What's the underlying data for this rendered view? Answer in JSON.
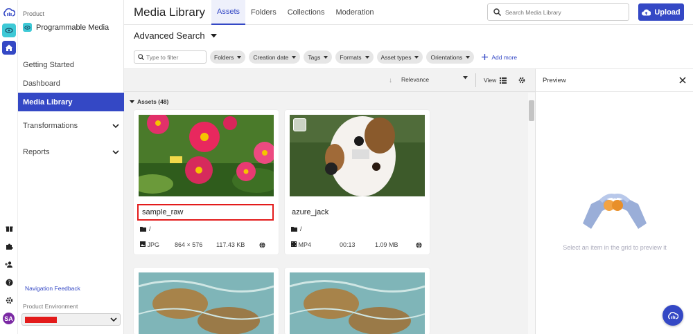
{
  "sidebar": {
    "product_label": "Product",
    "product_name": "Programmable Media",
    "items": [
      {
        "label": "Getting Started"
      },
      {
        "label": "Dashboard"
      },
      {
        "label": "Media Library"
      },
      {
        "label": "Transformations"
      },
      {
        "label": "Reports"
      }
    ],
    "feedback_link": "Navigation Feedback",
    "env_label": "Product Environment",
    "avatar_initials": "SA"
  },
  "header": {
    "title": "Media Library",
    "tabs": [
      {
        "label": "Assets"
      },
      {
        "label": "Folders"
      },
      {
        "label": "Collections"
      },
      {
        "label": "Moderation"
      }
    ],
    "search_placeholder": "Search Media Library",
    "upload_label": "Upload"
  },
  "search": {
    "advanced_label": "Advanced Search",
    "filter_placeholder": "Type to filter",
    "chips": [
      "Folders",
      "Creation date",
      "Tags",
      "Formats",
      "Asset types",
      "Orientations"
    ],
    "add_more": "Add more"
  },
  "grid": {
    "sort_label": "Relevance",
    "view_label": "View",
    "assets_count": "Assets (48)",
    "cards": [
      {
        "name": "sample_raw",
        "folder": "/",
        "type": "JPG",
        "info": "864 × 576",
        "size": "117.43 KB"
      },
      {
        "name": "azure_jack",
        "folder": "/",
        "type": "MP4",
        "info": "00:13",
        "size": "1.09 MB"
      }
    ]
  },
  "preview": {
    "title": "Preview",
    "hint": "Select an item in the grid to preview it"
  },
  "colors": {
    "accent": "#3448c5",
    "highlight": "#e31b1b",
    "teal": "#3ec9d6"
  }
}
